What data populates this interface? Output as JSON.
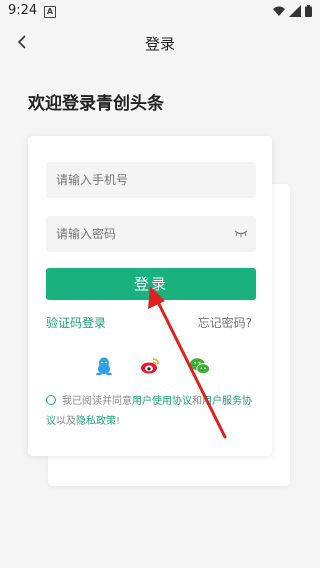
{
  "status_bar": {
    "time": "9:24",
    "notification_glyph": "A"
  },
  "header": {
    "title": "登录"
  },
  "welcome_text": "欢迎登录青创头条",
  "form": {
    "phone_placeholder": "请输入手机号",
    "password_placeholder": "请输入密码",
    "login_label": "登录",
    "sms_login_label": "验证码登录",
    "forgot_password_label": "忘记密码?"
  },
  "agreement": {
    "prefix": "我已阅读并同意",
    "user_agreement": "用户使用协议",
    "middle": "和",
    "service_agreement": "用户服务协议",
    "and": "以及",
    "privacy_policy": "隐私政策",
    "suffix": "!"
  },
  "colors": {
    "accent": "#19b17d",
    "annotation_arrow": "#e02020",
    "qq": "#2c9fe6",
    "weibo": "#e6162d",
    "wechat": "#3cb034"
  },
  "icons": [
    "wifi-icon",
    "signal-icon",
    "battery-icon",
    "back-arrow-icon",
    "eye-closed-icon",
    "qq-icon",
    "weibo-icon",
    "wechat-icon"
  ]
}
